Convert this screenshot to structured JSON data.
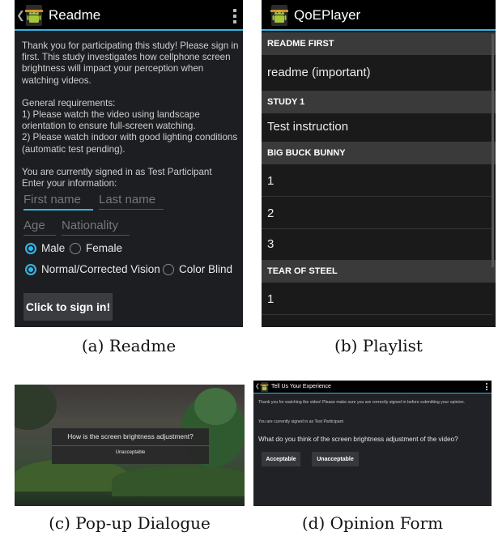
{
  "readme": {
    "title": "Readme",
    "intro": "Thank you for participating this study! Please sign in first. This study investigates how cellphone screen brightness will impact your perception when watching videos.",
    "req_title": "General requirements:",
    "req1": "1) Please watch the video using landscape orientation to ensure full-screen watching.",
    "req2": "2) Please watch indoor with good lighting conditions (automatic test pending).",
    "signed": "You are currently signed in as Test Participant",
    "enter": "Enter your information:",
    "first_name_placeholder": "First name",
    "last_name_placeholder": "Last name",
    "age_placeholder": "Age",
    "nationality_placeholder": "Nationality",
    "gender_male": "Male",
    "gender_female": "Female",
    "vision_normal": "Normal/Corrected Vision",
    "vision_colorblind": "Color Blind",
    "sign_in_button": "Click to sign in!",
    "caption": "(a) Readme"
  },
  "playlist": {
    "title": "QoEPlayer",
    "sections": [
      {
        "header": "README FIRST",
        "items": [
          "readme (important)"
        ]
      },
      {
        "header": "STUDY 1",
        "items": [
          "Test instruction"
        ]
      },
      {
        "header": "BIG BUCK BUNNY",
        "items": [
          "1",
          "2",
          "3"
        ]
      },
      {
        "header": "TEAR OF STEEL",
        "items": [
          "1"
        ]
      }
    ],
    "caption": "(b) Playlist"
  },
  "popup": {
    "question": "How is the screen brightness adjustment?",
    "option": "Unacceptable",
    "caption": "(c) Pop-up Dialogue"
  },
  "opinion": {
    "title": "Tell Us Your Experience",
    "thanks": "Thank you for watching the video! Please make sure you are correctly signed in before submitting your opinion.",
    "signed": "You are currently signed in as Test Participant",
    "question": "What do you think of the screen brightness adjustment of the video?",
    "accept_button": "Acceptable",
    "reject_button": "Unacceptable",
    "caption": "(d) Opinion Form"
  },
  "colors": {
    "accent": "#33b5e5",
    "actionbar": "#000000",
    "app_bg": "#1c1e21",
    "android_green": "#a4c639"
  }
}
